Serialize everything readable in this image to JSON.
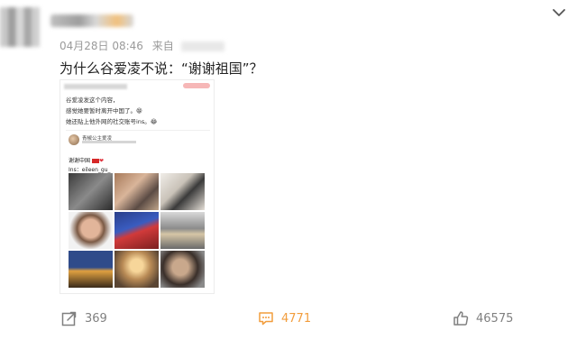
{
  "post": {
    "timestamp": "04月28日 08:46",
    "source_prefix": "来自",
    "text": "为什么谷爱凌不说：“谢谢祖国”？"
  },
  "embedded": {
    "lines": [
      "谷爱凌发这个内容，",
      "感觉她要暂时离开中国了。😁",
      "她还贴上他外网的社交账号ins。😂"
    ],
    "card": {
      "name": "青椒公主爱凌",
      "text_line1": "谢谢中国",
      "text_line2": "Ins：eileen_gu_"
    }
  },
  "actions": {
    "forward_count": "369",
    "comment_count": "4771",
    "like_count": "46575"
  },
  "colors": {
    "accent_orange": "#f29d3d",
    "muted_gray": "#808080"
  },
  "icons": {
    "menu": "chevron-down-icon",
    "forward": "share-icon",
    "comment": "comment-icon",
    "like": "thumbs-up-icon"
  }
}
